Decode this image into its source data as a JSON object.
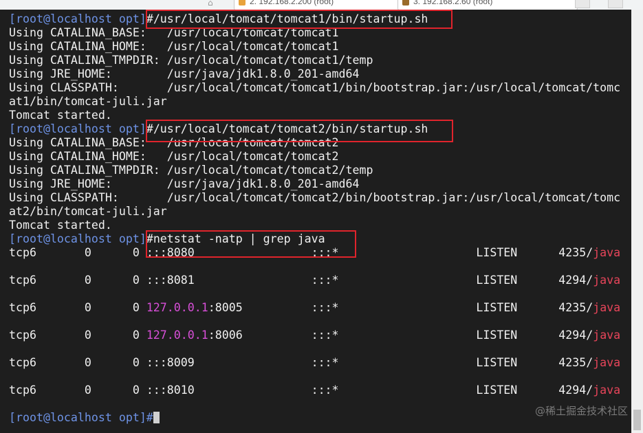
{
  "tabs": [
    {
      "label": "2. 192.168.2.200 (root)"
    },
    {
      "label": "3. 192.168.2.60 (root)"
    }
  ],
  "terminal": {
    "prompt": "[root@localhost opt]",
    "cmd1": "/usr/local/tomcat/tomcat1/bin/startup.sh",
    "tomcat1": {
      "base": "Using CATALINA_BASE:   /usr/local/tomcat/tomcat1",
      "home": "Using CATALINA_HOME:   /usr/local/tomcat/tomcat1",
      "tmpdir": "Using CATALINA_TMPDIR: /usr/local/tomcat/tomcat1/temp",
      "jre": "Using JRE_HOME:        /usr/java/jdk1.8.0_201-amd64",
      "classpath": "Using CLASSPATH:       /usr/local/tomcat/tomcat1/bin/bootstrap.jar:/usr/local/tomcat/tomc",
      "classpath2": "at1/bin/tomcat-juli.jar",
      "started": "Tomcat started."
    },
    "cmd2": "/usr/local/tomcat/tomcat2/bin/startup.sh",
    "tomcat2": {
      "base": "Using CATALINA_BASE:   /usr/local/tomcat/tomcat2",
      "home": "Using CATALINA_HOME:   /usr/local/tomcat/tomcat2",
      "tmpdir": "Using CATALINA_TMPDIR: /usr/local/tomcat/tomcat2/temp",
      "jre": "Using JRE_HOME:        /usr/java/jdk1.8.0_201-amd64",
      "classpath": "Using CLASSPATH:       /usr/local/tomcat/tomcat2/bin/bootstrap.jar:/usr/local/tomcat/tomc",
      "classpath2": "at2/bin/tomcat-juli.jar",
      "started": "Tomcat started."
    },
    "cmd3": "netstat -natp | grep java",
    "netstat": [
      {
        "a": "tcp6       0      0 ",
        "hl": "",
        "b": ":::8080                 :::*                    LISTEN      4235/",
        "java": "java"
      },
      {
        "a": "tcp6       0      0 ",
        "hl": "",
        "b": ":::8081                 :::*                    LISTEN      4294/",
        "java": "java"
      },
      {
        "a": "tcp6       0      0 ",
        "hl": "127.0.0.1",
        "b": ":8005          :::*                    LISTEN      4235/",
        "java": "java"
      },
      {
        "a": "tcp6       0      0 ",
        "hl": "127.0.0.1",
        "b": ":8006          :::*                    LISTEN      4294/",
        "java": "java"
      },
      {
        "a": "tcp6       0      0 ",
        "hl": "",
        "b": ":::8009                 :::*                    LISTEN      4235/",
        "java": "java"
      },
      {
        "a": "tcp6       0      0 ",
        "hl": "",
        "b": ":::8010                 :::*                    LISTEN      4294/",
        "java": "java"
      }
    ],
    "final_prompt": "[root@localhost opt]#"
  },
  "watermark": "@稀土掘金技术社区",
  "colors": {
    "background": "#1e1e1e",
    "text": "#f0f0f0",
    "prompt": "#6e93e6",
    "ip": "#d84fd8",
    "java": "#e8455a",
    "highlight_box": "#e0242c"
  }
}
